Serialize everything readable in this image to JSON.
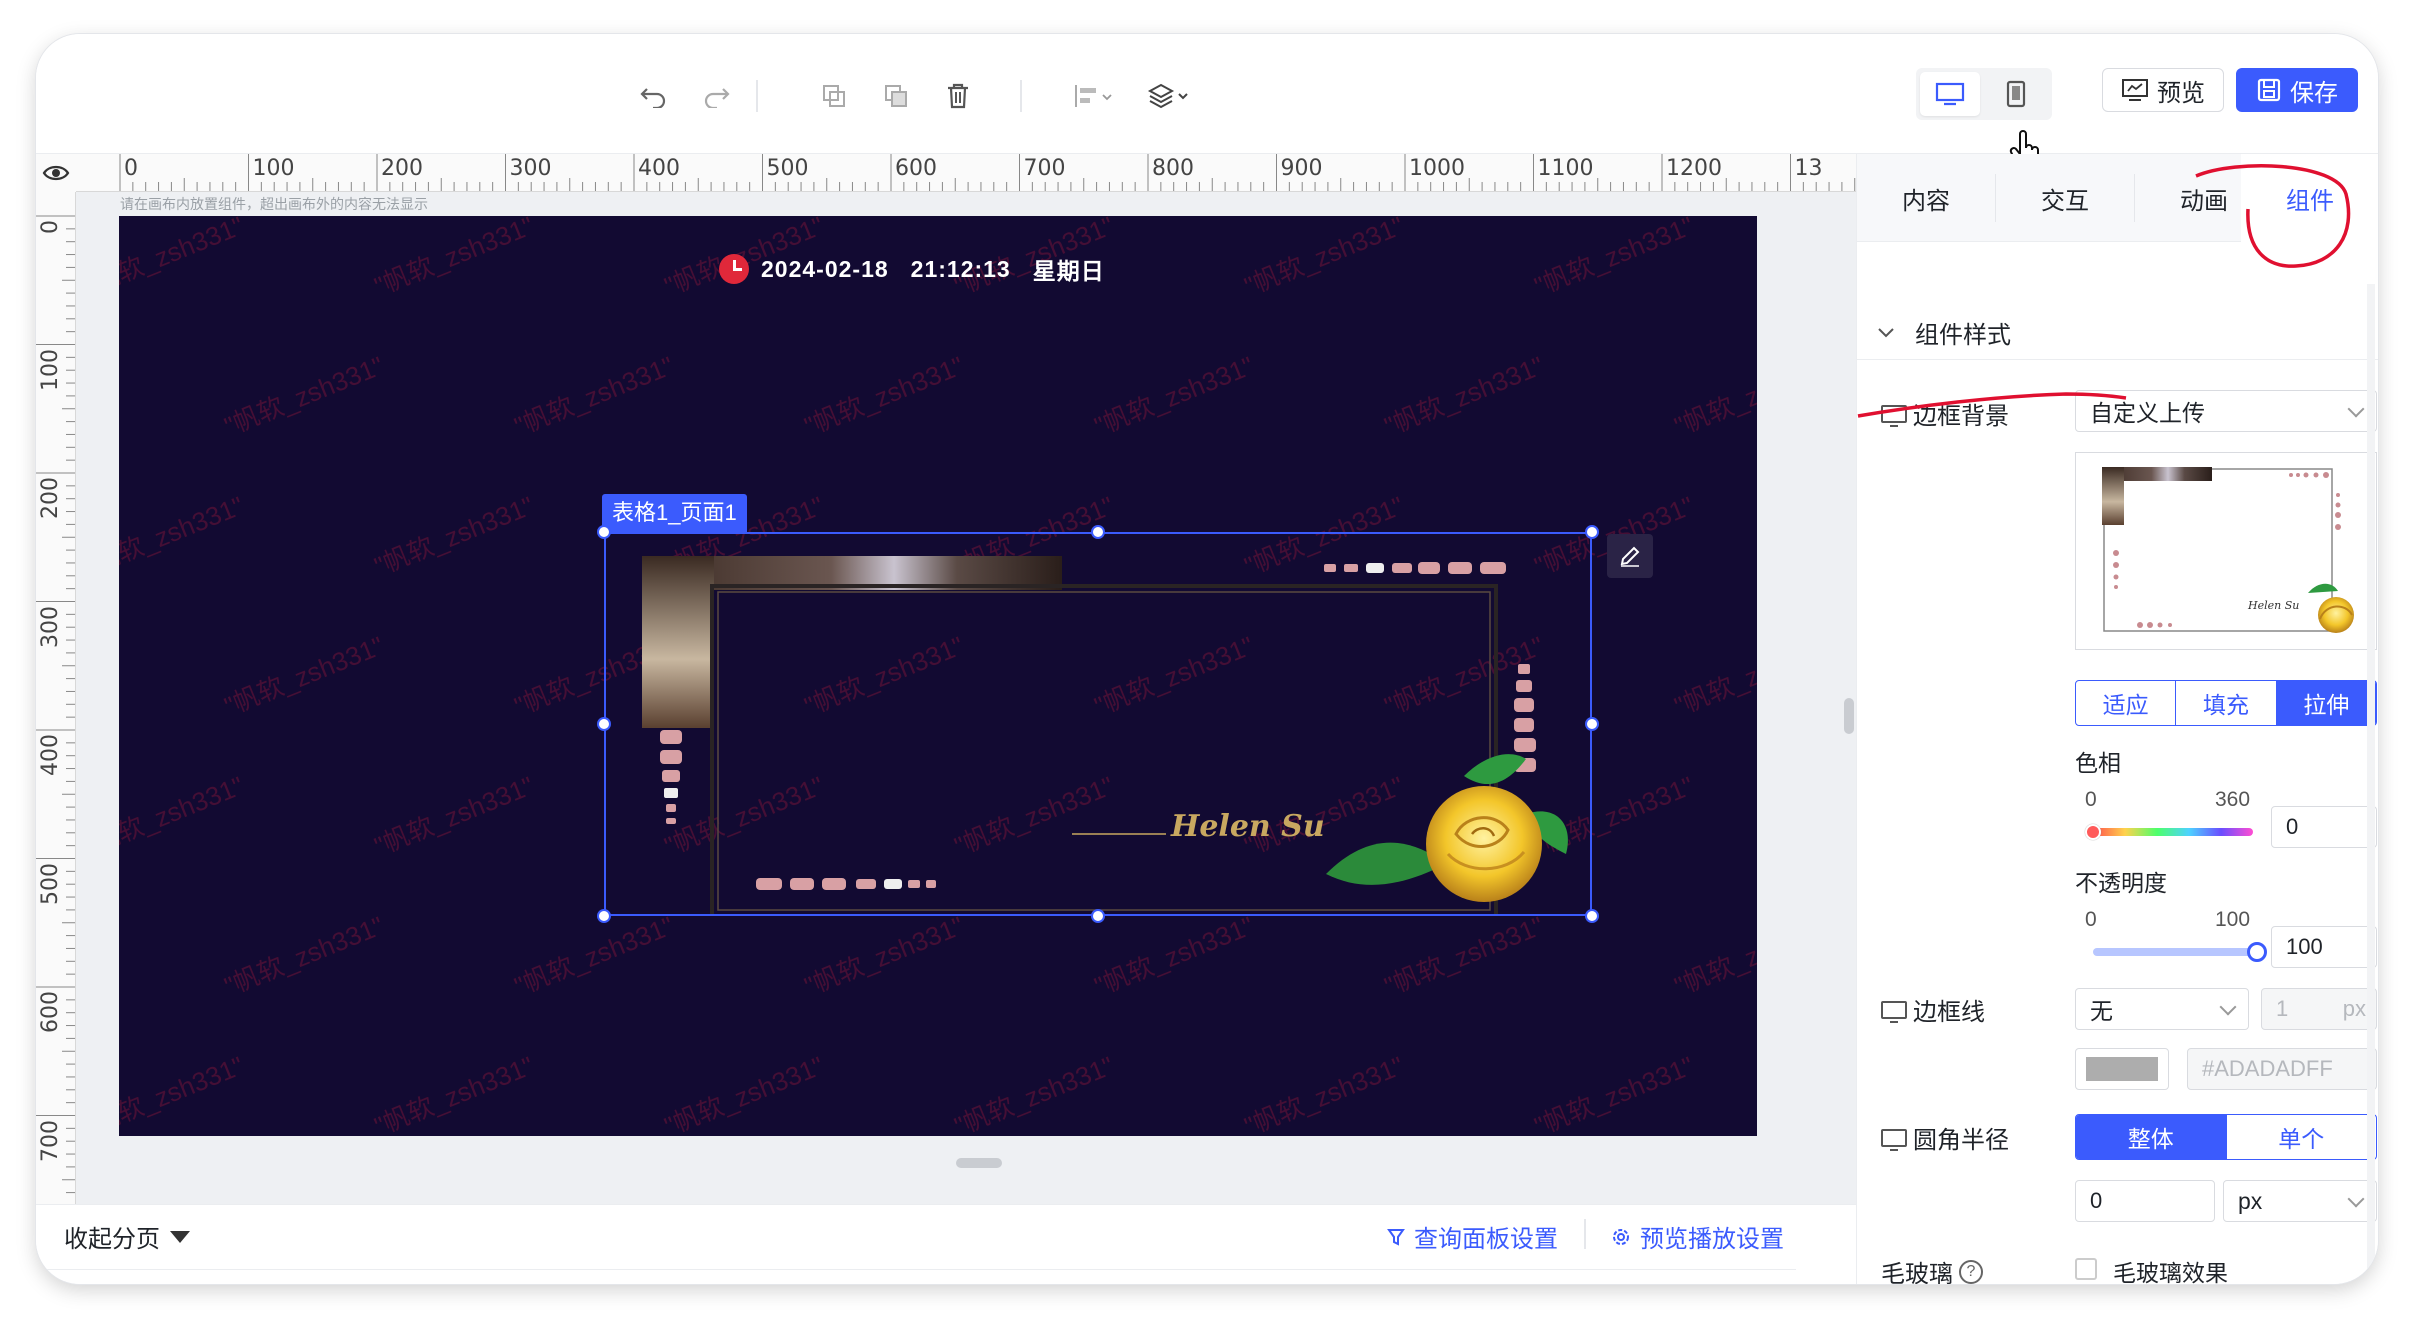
{
  "toolbar": {
    "undo_icon": "undo-icon",
    "redo_icon": "redo-icon",
    "copy_icon": "copy-icon",
    "paste_icon": "paste-icon",
    "delete_icon": "trash-icon",
    "align_icon": "align-icon",
    "layer_icon": "layer-icon",
    "preview_label": "预览",
    "save_label": "保存"
  },
  "ruler": {
    "top": [
      "0",
      "100",
      "200",
      "300",
      "400",
      "500",
      "600",
      "700",
      "800",
      "900",
      "1000",
      "1100",
      "1200",
      "13"
    ],
    "left": [
      "0",
      "100",
      "200",
      "300",
      "400",
      "500",
      "600",
      "700"
    ]
  },
  "canvas": {
    "hint": "请在画布内放置组件，超出画布外的内容无法显示",
    "clock": {
      "date": "2024-02-18",
      "time": "21:12:13",
      "weekday": "星期日"
    },
    "selected_label": "表格1_页面1",
    "watermark": "\"帆软_zsh331\"",
    "frame_signature": "Helen Su",
    "background_color": "#120a32"
  },
  "pages": {
    "collapse_label": "收起分页",
    "query_panel_label": "查询面板设置",
    "preview_play_label": "预览播放设置"
  },
  "panel": {
    "tabs": [
      "内容",
      "交互",
      "动画",
      "组件"
    ],
    "active_tab": "组件",
    "section_title": "组件样式",
    "border_bg": {
      "label": "边框背景",
      "value": "自定义上传",
      "fit_options": [
        "适应",
        "填充",
        "拉伸"
      ],
      "fit_selected": "拉伸"
    },
    "hue": {
      "label": "色相",
      "min": "0",
      "max": "360",
      "value": "0"
    },
    "opacity": {
      "label": "不透明度",
      "min": "0",
      "max": "100",
      "value": "100"
    },
    "border_line": {
      "label": "边框线",
      "style": "无",
      "width": "1",
      "unit": "px",
      "color_hex": "#ADADADFF"
    },
    "radius": {
      "label": "圆角半径",
      "modes": [
        "整体",
        "单个"
      ],
      "mode_selected": "整体",
      "value": "0",
      "unit": "px"
    },
    "glass": {
      "label": "毛玻璃",
      "checkbox_label": "毛玻璃效果",
      "checked": false
    }
  },
  "colors": {
    "accent": "#3b5bfd",
    "annotation_red": "#e01030"
  }
}
